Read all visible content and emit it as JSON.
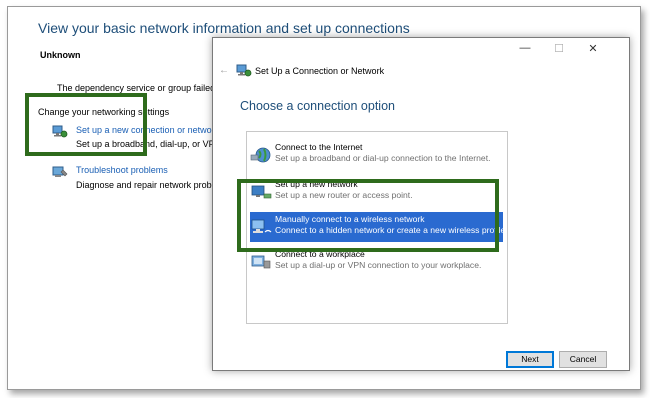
{
  "background_window": {
    "title": "View your basic network information and set up connections",
    "network_name": "Unknown",
    "dependency_message": "The dependency service or group failed to",
    "change_settings_label": "Change your networking settings",
    "items": [
      {
        "link": "Set up a new connection or network",
        "desc": "Set up a broadband, dial-up, or VPN",
        "icon": "network-setup-icon"
      },
      {
        "link": "Troubleshoot problems",
        "desc": "Diagnose and repair network problem",
        "icon": "troubleshoot-icon"
      }
    ]
  },
  "dialog": {
    "window_controls": {
      "minimize": "—",
      "maximize": "☐",
      "close": "✕"
    },
    "back_icon": "back-arrow-icon",
    "title": "Set Up a Connection or Network",
    "heading": "Choose a connection option",
    "options": [
      {
        "name": "Connect to the Internet",
        "desc": "Set up a broadband or dial-up connection to the Internet.",
        "icon": "globe-network-icon",
        "selected": false
      },
      {
        "name": "Set up a new network",
        "desc": "Set up a new router or access point.",
        "icon": "router-icon",
        "selected": false
      },
      {
        "name": "Manually connect to a wireless network",
        "desc": "Connect to a hidden network or create a new wireless profile.",
        "icon": "wireless-network-icon",
        "selected": true
      },
      {
        "name": "Connect to a workplace",
        "desc": "Set up a dial-up or VPN connection to your workplace.",
        "icon": "workplace-icon",
        "selected": false
      }
    ],
    "buttons": {
      "next": "Next",
      "cancel": "Cancel"
    }
  },
  "colors": {
    "heading_blue": "#1e4e79",
    "link_blue": "#1a5fb4",
    "selection_blue": "#2a6ad0",
    "highlight_green": "#2e6b1c"
  }
}
